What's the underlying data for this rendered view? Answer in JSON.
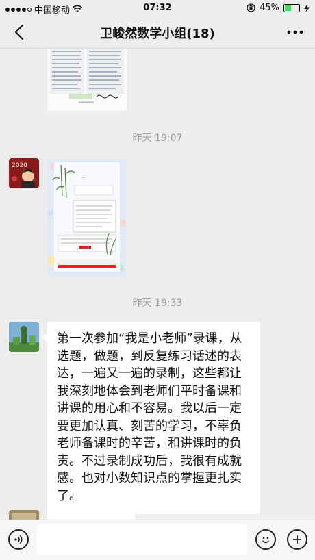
{
  "status_bar": {
    "carrier": "中国移动",
    "time": "07:32",
    "battery": "45%",
    "battery_level": 0.45
  },
  "nav": {
    "title": "卫峻然数学小组(18)"
  },
  "chat": {
    "timestamps": [
      "昨天 19:07",
      "昨天 19:33"
    ],
    "avatar1_text": "2020",
    "text_message": "第一次参加“我是小老师”录课，从选题，做题，到反复练习话述的表达，一遍又一遍的录制，这些都让我深刻地体会到老师们平时备课和讲课的用心和不容易。我以后一定要更加认真、刻苦的学习，不辜负老师备课时的辛苦，和讲课时的负责。不过录制成功后，我很有成就感。也对小数知识点的掌握更扎实了。"
  },
  "input_bar": {
    "placeholder": ""
  },
  "colors": {
    "background": "#ededed",
    "bubble": "#ffffff",
    "battery_fill": "#4cd964"
  }
}
